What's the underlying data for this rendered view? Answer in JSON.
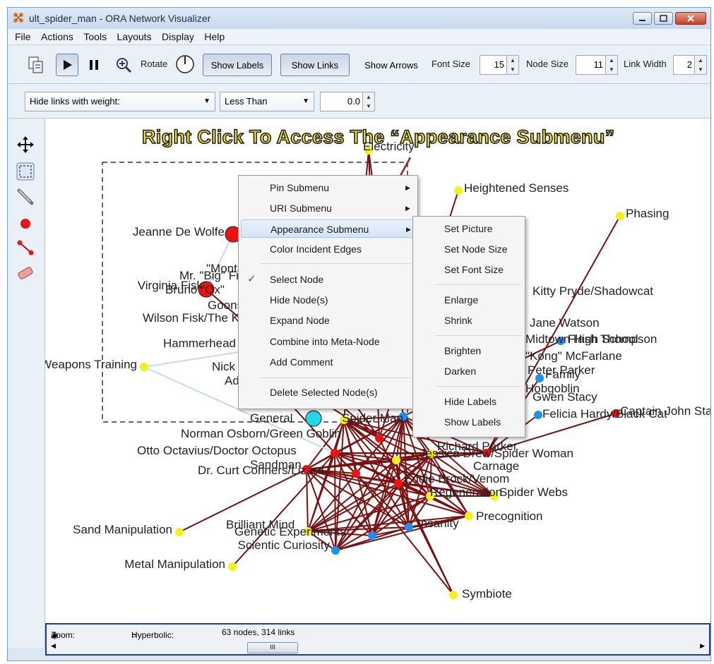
{
  "window": {
    "title": "ult_spider_man - ORA Network Visualizer"
  },
  "menubar": [
    "File",
    "Actions",
    "Tools",
    "Layouts",
    "Display",
    "Help"
  ],
  "toolbar": {
    "rotate_label": "Rotate",
    "show_labels": "Show Labels",
    "show_links": "Show Links",
    "show_arrows": "Show Arrows",
    "font_size_label": "Font Size",
    "font_size_value": "15",
    "node_size_label": "Node Size",
    "node_size_value": "11",
    "link_width_label": "Link Width",
    "link_width_value": "2"
  },
  "filter": {
    "hide_links_label": "Hide links with weight:",
    "comparison": "Less Than",
    "threshold": "0.0"
  },
  "annotation": "Right Click To Access The “Appearance Submenu”",
  "context_menu": {
    "items": [
      {
        "label": "Pin Submenu",
        "submenu": true
      },
      {
        "label": "URI Submenu",
        "submenu": true
      },
      {
        "label": "Appearance Submenu",
        "submenu": true,
        "highlighted": true
      },
      {
        "label": "Color Incident Edges"
      },
      {
        "label": "Select Node",
        "checked": true
      },
      {
        "label": "Hide Node(s)"
      },
      {
        "label": "Expand Node"
      },
      {
        "label": "Combine into Meta-Node"
      },
      {
        "label": "Add Comment"
      },
      {
        "label": "Delete Selected Node(s)"
      }
    ]
  },
  "appearance_submenu": {
    "items": [
      "Set Picture",
      "Set Node Size",
      "Set Font Size",
      "Enlarge",
      "Shrink",
      "Brighten",
      "Darken",
      "Hide Labels",
      "Show Labels"
    ]
  },
  "status": {
    "zoom": "Zoom: -8",
    "hyperbolic": "Hyperbolic: 0",
    "summary": "63 nodes, 314 links"
  },
  "scroll_thumb": "III",
  "colors": {
    "edge": "#7b1010",
    "agent": "#ee1111",
    "resource": "#f2f21a",
    "org": "#1e90ee",
    "selected": "#22d8e8",
    "annotation": "#f4e21a"
  },
  "node_labels": [
    "Heightened Senses",
    "Phasing",
    "Jeanne De Wolfe",
    "\"Montana\"",
    "Mr. \"Big\" Fredo",
    "Virginia Fisk",
    "Bruno \"Ox\"",
    "Goons",
    "Wilson Fisk/The Kingpin",
    "Hammerhead",
    "Weapons Training",
    "Nick Fury",
    "Advanced",
    "Jane Watson",
    "Midtown High School",
    "Flash Thompson",
    "Kitty Pryde/Shadowcat",
    "Peter Parker",
    "\"Kong\" McFarlane",
    "Family",
    "Hobgoblin",
    "Gwen Stacy",
    "Felicia Hardy/Black Cat",
    "Captain John Stacy",
    "Norman Osborn/Green Goblin",
    "Otto Octavius/Doctor Octopus",
    "Sandman",
    "Dr. Curt Conners/Lizard",
    "Richard Parker",
    "Jessica Drew/Spider Woman",
    "Carnage",
    "Eddie Brock/Venom",
    "Regeneration",
    "Spider Webs",
    "Precognition",
    "Sand Manipulation",
    "Brilliant Mind",
    "Genetic Experiments",
    "Scientic Curiosity",
    "Insanity",
    "Metal Manipulation",
    "Symbiote",
    "Electricity",
    "General",
    "Spider Man"
  ]
}
